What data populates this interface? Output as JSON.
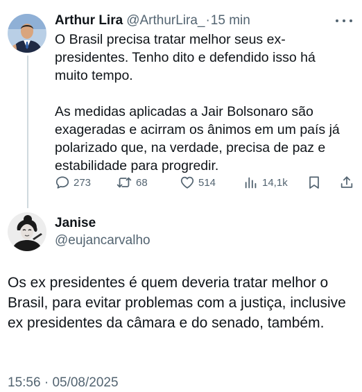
{
  "tweet": {
    "author_name": "Arthur Lira",
    "author_handle": "@ArthurLira_",
    "separator": "·",
    "time_ago": "15 min",
    "paragraph_1": "O Brasil precisa tratar melhor seus ex-presidentes. Tenho dito e defendido isso há muito tempo.",
    "paragraph_2": "As medidas aplicadas a Jair Bolsonaro são exageradas e acirram os ânimos em um país já polarizado que, na verdade, precisa de paz e estabilidade para progredir.",
    "reply_count": "273",
    "retweet_count": "68",
    "like_count": "514",
    "view_count": "14,1k"
  },
  "reply": {
    "author_name": "Janise",
    "author_handle": "@eujancarvalho",
    "text": "Os ex presidentes é quem deveria tratar melhor o Brasil, para evitar problemas com a justiça, inclusive ex presidentes da câmara e do senado, também.",
    "time": "15:56",
    "separator": "·",
    "date": "05/08/2025"
  },
  "icons": {
    "reply": "speech-bubble-icon",
    "retweet": "retweet-arrows-icon",
    "like": "heart-icon",
    "views": "bar-chart-icon",
    "bookmark": "bookmark-icon",
    "share": "share-upload-icon",
    "more": "more-dots-icon"
  },
  "colors": {
    "text_primary": "#0f1419",
    "text_secondary": "#536471",
    "thread_line": "#cfd9de"
  }
}
